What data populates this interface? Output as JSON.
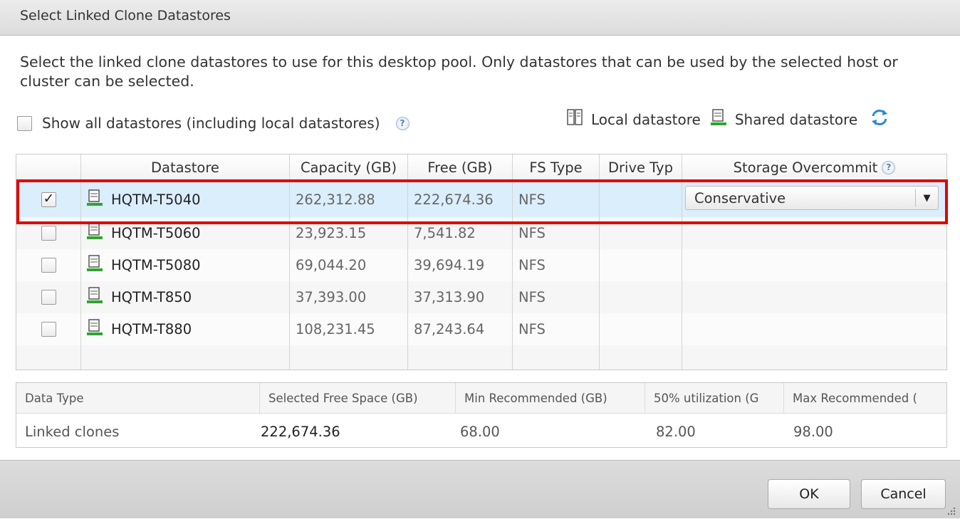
{
  "dialog": {
    "title": "Select Linked Clone Datastores"
  },
  "description": "Select the linked clone datastores to use for this desktop pool. Only datastores that can be used by the selected host or cluster can be selected.",
  "show_all": {
    "label": "Show all datastores (including local datastores)",
    "checked": false,
    "help_icon": "help-icon"
  },
  "legend": {
    "local_label": "Local datastore",
    "local_icon": "local-datastore-icon",
    "shared_label": "Shared datastore",
    "shared_icon": "shared-datastore-icon",
    "refresh_icon": "refresh-icon"
  },
  "grid": {
    "columns": [
      "",
      "Datastore",
      "Capacity (GB)",
      "Free (GB)",
      "FS Type",
      "Drive Typ",
      "Storage Overcommit"
    ],
    "rows": [
      {
        "checked": true,
        "name": "HQTM-T5040",
        "capacity": "262,312.88",
        "free": "222,674.36",
        "fs": "NFS",
        "drive": "",
        "overcommit": "Conservative"
      },
      {
        "checked": false,
        "name": "HQTM-T5060",
        "capacity": "23,923.15",
        "free": "7,541.82",
        "fs": "NFS",
        "drive": "",
        "overcommit": ""
      },
      {
        "checked": false,
        "name": "HQTM-T5080",
        "capacity": "69,044.20",
        "free": "39,694.19",
        "fs": "NFS",
        "drive": "",
        "overcommit": ""
      },
      {
        "checked": false,
        "name": "HQTM-T850",
        "capacity": "37,393.00",
        "free": "37,313.90",
        "fs": "NFS",
        "drive": "",
        "overcommit": ""
      },
      {
        "checked": false,
        "name": "HQTM-T880",
        "capacity": "108,231.45",
        "free": "87,243.64",
        "fs": "NFS",
        "drive": "",
        "overcommit": ""
      }
    ],
    "selected_row": 0
  },
  "summary": {
    "headers": [
      "Data Type",
      "Selected Free Space (GB)",
      "Min Recommended (GB)",
      "50% utilization (G",
      "Max Recommended ("
    ],
    "row": [
      "Linked clones",
      "222,674.36",
      "68.00",
      "82.00",
      "98.00"
    ]
  },
  "buttons": {
    "ok": "OK",
    "cancel": "Cancel"
  },
  "colors": {
    "selection": "#dbeefc",
    "highlight": "#e30000",
    "shared_icon": "#2fa52f"
  }
}
